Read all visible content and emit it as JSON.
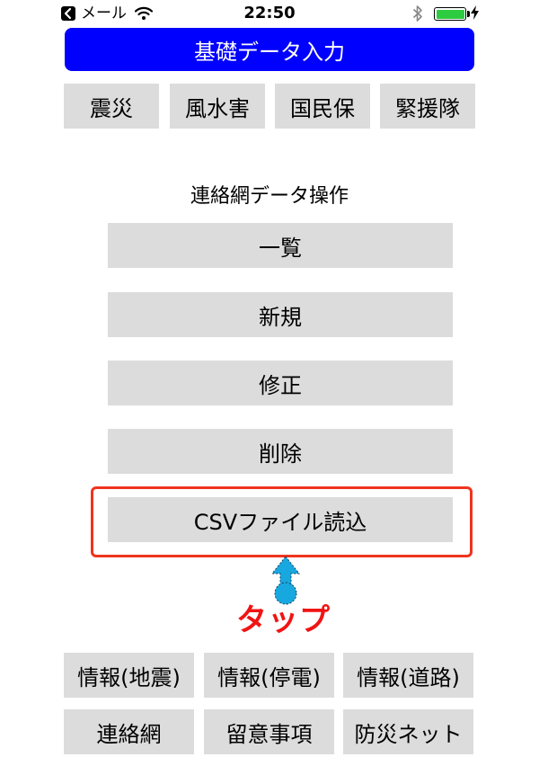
{
  "status_bar": {
    "carrier": "メール",
    "time": "22:50"
  },
  "header": {
    "title": "基礎データ入力"
  },
  "category_tabs": [
    "震災",
    "風水害",
    "国民保",
    "緊援隊"
  ],
  "section": {
    "title": "連絡網データ操作",
    "buttons": [
      "一覧",
      "新規",
      "修正",
      "削除",
      "CSVファイル読込"
    ]
  },
  "annotation": {
    "label": "タップ",
    "color": "#f01414"
  },
  "bottom_buttons": [
    "情報(地震)",
    "情報(停電)",
    "情報(道路)",
    "連絡網",
    "留意事項",
    "防災ネット"
  ],
  "colors": {
    "header_bg": "#0000ff",
    "button_bg": "#dcdcdc",
    "highlight": "#f0341e",
    "battery": "#2ecc40",
    "pointer": "#18a8e0"
  }
}
